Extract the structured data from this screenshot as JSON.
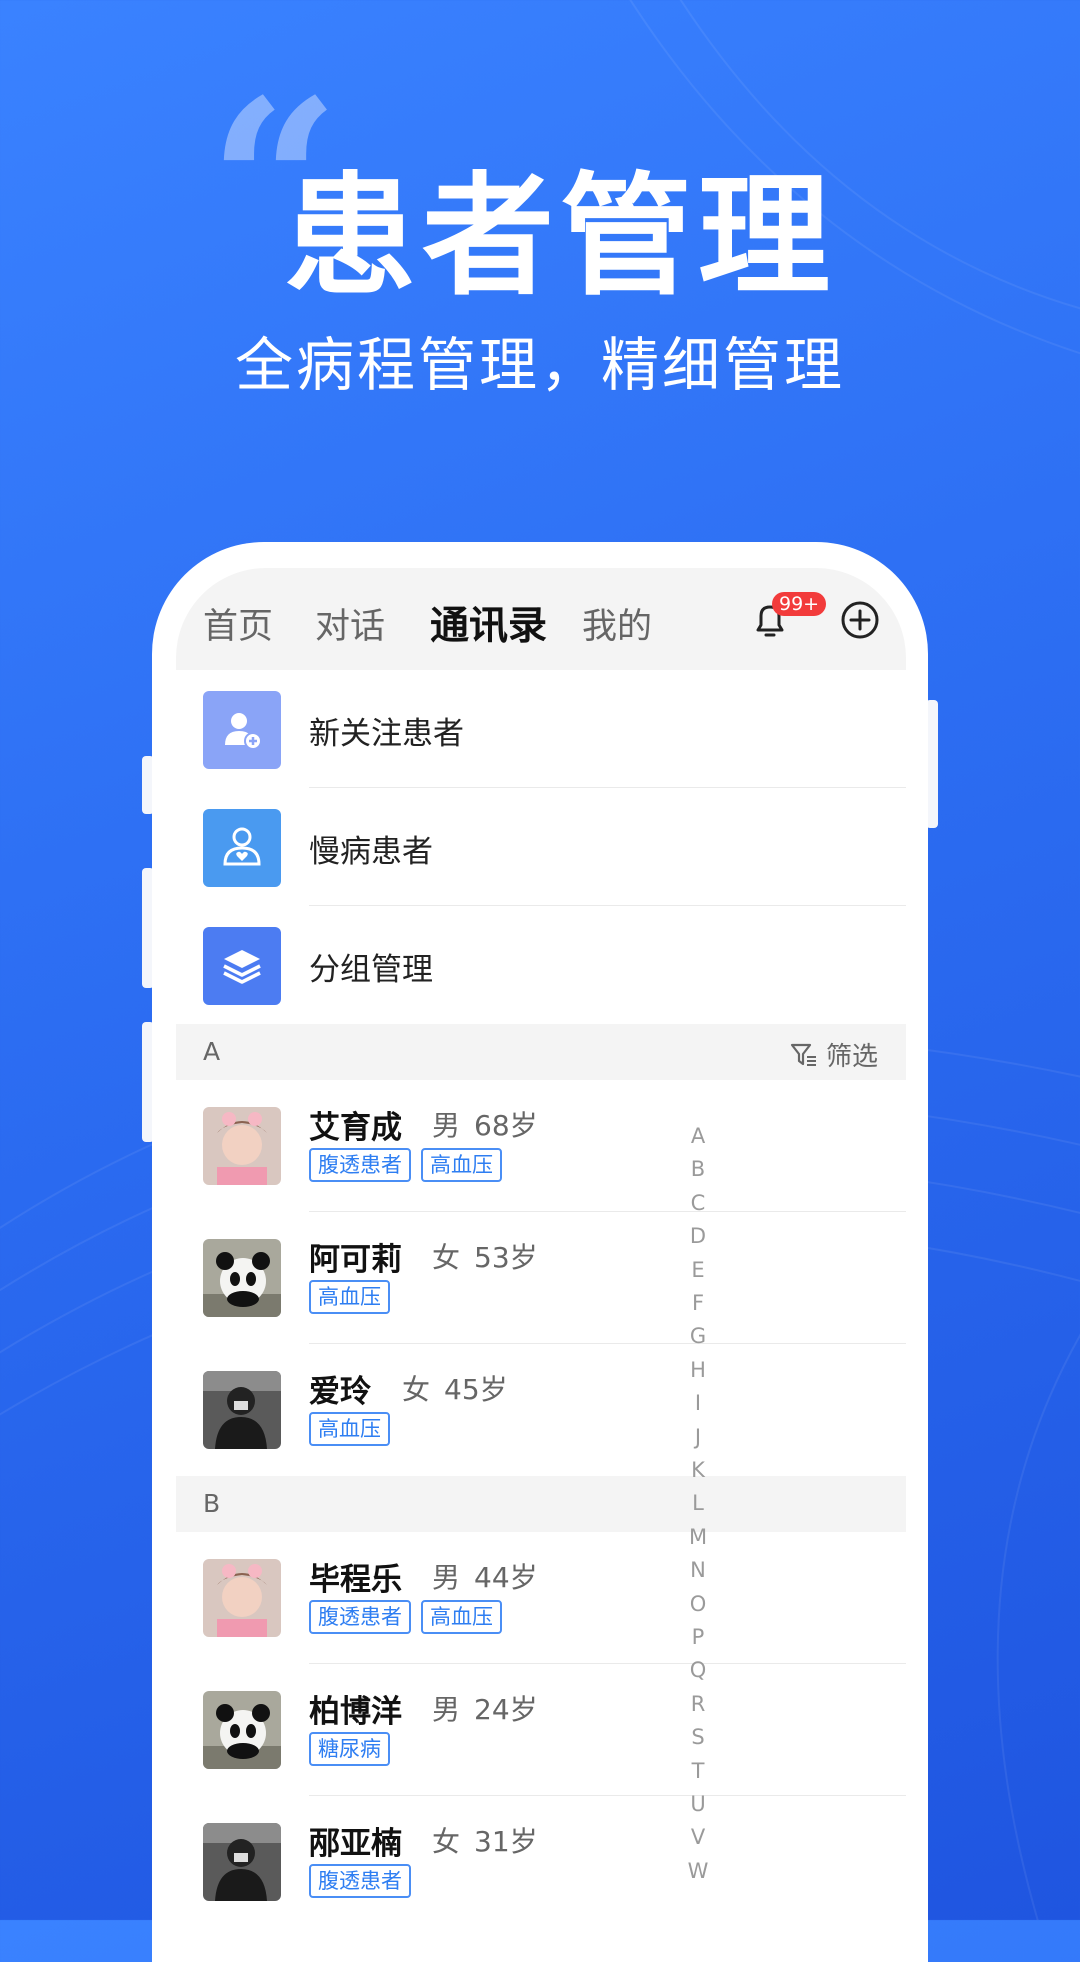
{
  "hero": {
    "quote": "“",
    "title": "患者管理",
    "subtitle": "全病程管理，精细管理"
  },
  "colors": {
    "background": "#2c6df2",
    "tag": "#2e7ef2",
    "badge": "#f23b3b",
    "icon_new": "#8aa4f7",
    "icon_chronic": "#4a9af0",
    "icon_group": "#4c7cf2"
  },
  "nav": {
    "tabs": [
      "首页",
      "对话",
      "通讯录",
      "我的"
    ],
    "active": "通讯录",
    "notification_badge": "99+",
    "icons": [
      "bell-icon",
      "add-circle-icon"
    ]
  },
  "menu": [
    {
      "label": "新关注患者",
      "icon": "add-user-icon"
    },
    {
      "label": "慢病患者",
      "icon": "chronic-patient-icon"
    },
    {
      "label": "分组管理",
      "icon": "layers-icon"
    }
  ],
  "filter_label": "筛选",
  "sections": [
    {
      "letter": "A",
      "patients": [
        {
          "name": "艾育成",
          "gender": "男",
          "age": "68岁",
          "tags": [
            "腹透患者",
            "高血压"
          ],
          "avatar": "girl-photo"
        },
        {
          "name": "阿可莉",
          "gender": "女",
          "age": "53岁",
          "tags": [
            "高血压"
          ],
          "avatar": "panda-photo"
        },
        {
          "name": "爱玲",
          "gender": "女",
          "age": "45岁",
          "tags": [
            "高血压"
          ],
          "avatar": "car-person-photo"
        }
      ]
    },
    {
      "letter": "B",
      "patients": [
        {
          "name": "毕程乐",
          "gender": "男",
          "age": "44岁",
          "tags": [
            "腹透患者",
            "高血压"
          ],
          "avatar": "girl-photo"
        },
        {
          "name": "柏博洋",
          "gender": "男",
          "age": "24岁",
          "tags": [
            "糖尿病"
          ],
          "avatar": "panda-photo"
        },
        {
          "name": "邴亚楠",
          "gender": "女",
          "age": "31岁",
          "tags": [
            "腹透患者"
          ],
          "avatar": "car-person-photo"
        }
      ]
    }
  ],
  "index_letters": [
    "A",
    "B",
    "C",
    "D",
    "E",
    "F",
    "G",
    "H",
    "I",
    "J",
    "K",
    "L",
    "M",
    "N",
    "O",
    "P",
    "Q",
    "R",
    "S",
    "T",
    "U",
    "V",
    "W"
  ]
}
